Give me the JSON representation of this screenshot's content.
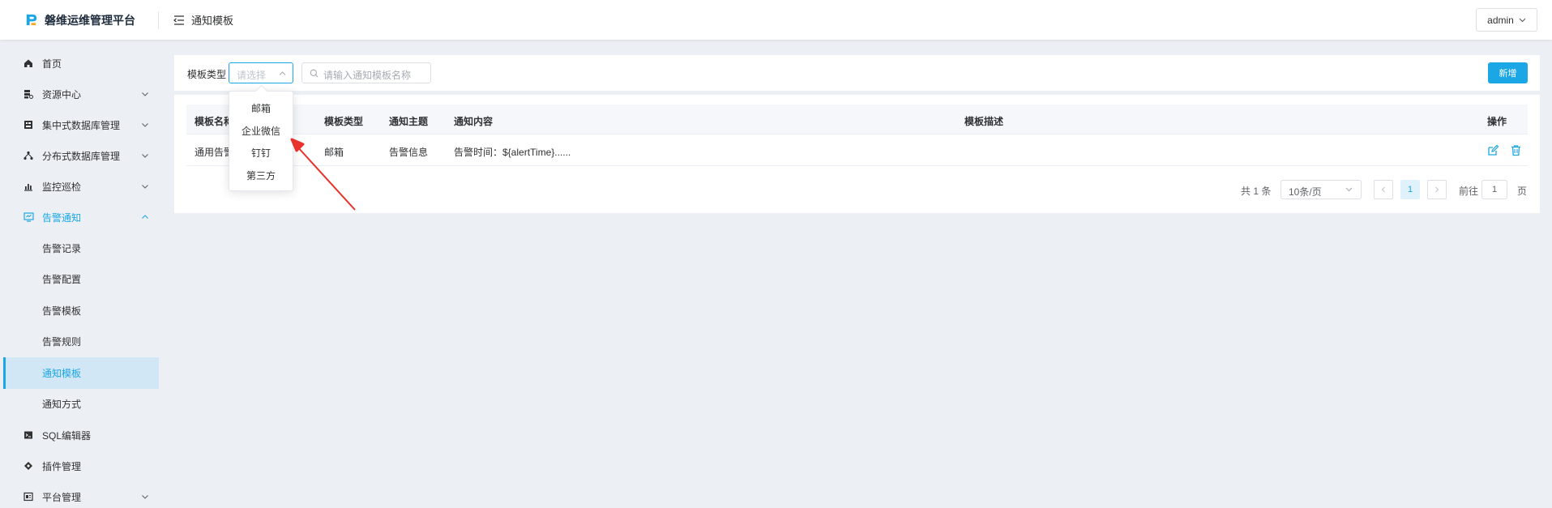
{
  "header": {
    "brand_name": "磐维运维管理平台",
    "breadcrumb": "通知模板",
    "user_name": "admin"
  },
  "sidebar": {
    "items": [
      {
        "label": "首页",
        "icon": "home-icon"
      },
      {
        "label": "资源中心",
        "icon": "resource-icon"
      },
      {
        "label": "集中式数据库管理",
        "icon": "database-icon"
      },
      {
        "label": "分布式数据库管理",
        "icon": "distributed-icon"
      },
      {
        "label": "监控巡检",
        "icon": "chart-icon"
      },
      {
        "label": "告警通知",
        "icon": "alert-monitor-icon"
      }
    ],
    "sub_items": [
      "告警记录",
      "告警配置",
      "告警模板",
      "告警规则",
      "通知模板",
      "通知方式"
    ],
    "bottom_items": [
      {
        "label": "SQL编辑器",
        "icon": "terminal-icon"
      },
      {
        "label": "插件管理",
        "icon": "plugin-icon"
      },
      {
        "label": "平台管理",
        "icon": "platform-icon"
      }
    ]
  },
  "toolbar": {
    "type_label": "模板类型",
    "type_placeholder": "请选择",
    "search_placeholder": "请输入通知模板名称",
    "add_label": "新增"
  },
  "dropdown": {
    "options": [
      "邮箱",
      "企业微信",
      "钉钉",
      "第三方"
    ]
  },
  "table": {
    "headers": [
      "模板名称",
      "模板类型",
      "通知主题",
      "通知内容",
      "模板描述",
      "操作"
    ],
    "rows": [
      {
        "name": "通用告警",
        "type": "邮箱",
        "subject": "告警信息",
        "content": "告警时间：${alertTime}......",
        "desc": ""
      }
    ]
  },
  "pagination": {
    "total": "共 1 条",
    "page_size": "10条/页",
    "current_page": "1",
    "goto_prefix": "前往",
    "goto_value": "1",
    "goto_suffix": "页"
  },
  "colors": {
    "accent": "#1ba6e6",
    "annotation_arrow": "#e8322c"
  }
}
